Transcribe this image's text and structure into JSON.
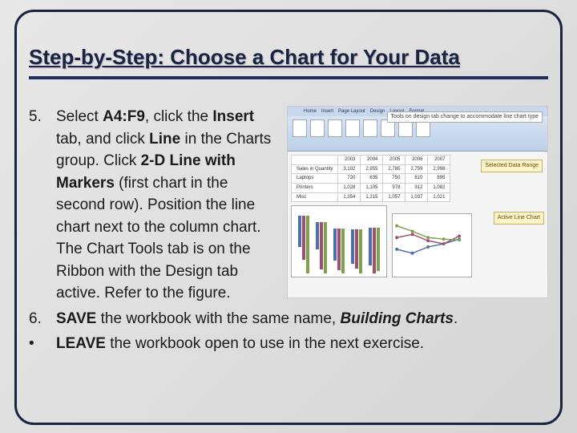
{
  "heading": "Step-by-Step: Choose a Chart for Your Data",
  "list": {
    "item5": {
      "num": "5.",
      "text_pre": "Select ",
      "bold_range": "A4:F9",
      "text_mid1": ", click the ",
      "bold_insert": "Insert",
      "text_mid2": " tab, and click ",
      "bold_line": "Line",
      "text_mid3": " in the Charts group. Click ",
      "bold_2dline": "2-D Line with Markers",
      "text_rest": " (first chart in the second row). Position the line chart next to the column chart. The Chart Tools tab is on the Ribbon with the Design tab active. Refer to the figure."
    },
    "item6": {
      "num": "6.",
      "bold_save": "SAVE",
      "text_mid": " the workbook with the same name, ",
      "bold_ital_name": "Building Charts",
      "text_end": "."
    },
    "itemBullet": {
      "num": "•",
      "bold_leave": "LEAVE",
      "text_rest": " the workbook open to use in the next exercise."
    }
  },
  "figure": {
    "callout_top": "Tools on design tab change to accommodate line chart type",
    "label_selrange": "Selected Data Range",
    "label_active": "Active Line Chart",
    "table_rows": [
      [
        "",
        "2003",
        "2004",
        "2005",
        "2006",
        "2007"
      ],
      [
        "Sales in Quantity",
        "3,102",
        "2,955",
        "2,785",
        "2,759",
        "2,998"
      ],
      [
        "Laptops",
        "720",
        "635",
        "750",
        "810",
        "895"
      ],
      [
        "Printers",
        "1,028",
        "1,105",
        "978",
        "912",
        "1,082"
      ],
      [
        "Misc",
        "1,354",
        "1,215",
        "1,057",
        "1,037",
        "1,021"
      ]
    ]
  },
  "chart_data": [
    {
      "type": "bar",
      "title": "",
      "categories": [
        "2003",
        "2004",
        "2005",
        "2006",
        "2007"
      ],
      "series": [
        {
          "name": "Laptops",
          "values": [
            720,
            635,
            750,
            810,
            895
          ]
        },
        {
          "name": "Printers",
          "values": [
            1028,
            1105,
            978,
            912,
            1082
          ]
        },
        {
          "name": "Misc",
          "values": [
            1354,
            1215,
            1057,
            1037,
            1021
          ]
        }
      ],
      "ylim": [
        0,
        1500
      ]
    },
    {
      "type": "line",
      "title": "",
      "categories": [
        "2003",
        "2004",
        "2005",
        "2006",
        "2007"
      ],
      "series": [
        {
          "name": "Laptops",
          "values": [
            720,
            635,
            750,
            810,
            895
          ]
        },
        {
          "name": "Printers",
          "values": [
            1028,
            1105,
            978,
            912,
            1082
          ]
        },
        {
          "name": "Misc",
          "values": [
            1354,
            1215,
            1057,
            1037,
            1021
          ]
        }
      ],
      "ylim": [
        0,
        1500
      ]
    }
  ]
}
